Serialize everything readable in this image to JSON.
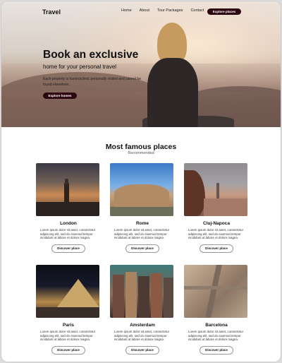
{
  "nav": {
    "brand": "Travel",
    "links": [
      "Home",
      "About",
      "Tour Packages",
      "Contact"
    ],
    "cta": "Explore places"
  },
  "hero": {
    "title": "Book an exclusive",
    "subtitle": "home for your personal travel",
    "description": "Each property is hand-picked, personally visited and cannot be found elsewhere.",
    "cta": "Explore homes"
  },
  "places_section": {
    "title": "Most famous places",
    "subtitle": "Recommended"
  },
  "places": [
    {
      "name": "London",
      "desc": "Lorem ipsum dolor sit amet, consectetur adipiscing elit, sed do eiusmod tempor incididunt ut labore et dolore magna.",
      "button": "Discover place"
    },
    {
      "name": "Rome",
      "desc": "Lorem ipsum dolor sit amet, consectetur adipiscing elit, sed do eiusmod tempor incididunt ut labore et dolore magna.",
      "button": "Discover place"
    },
    {
      "name": "Cluj-Napoca",
      "desc": "Lorem ipsum dolor sit amet, consectetur adipiscing elit, sed do eiusmod tempor incididunt ut labore et dolore magna.",
      "button": "Discover place"
    },
    {
      "name": "Paris",
      "desc": "Lorem ipsum dolor sit amet, consectetur adipiscing elit, sed do eiusmod tempor incididunt ut labore et dolore magna.",
      "button": "Discover place"
    },
    {
      "name": "Amsterdam",
      "desc": "Lorem ipsum dolor sit amet, consectetur adipiscing elit, sed do eiusmod tempor incididunt ut labore et dolore magna.",
      "button": "Discover place"
    },
    {
      "name": "Barcelona",
      "desc": "Lorem ipsum dolor sit amet, consectetur adipiscing elit, sed do eiusmod tempor incididunt ut labore et dolore magna.",
      "button": "Discover place"
    }
  ],
  "colors": {
    "accent": "#2e0611",
    "text": "#111111"
  }
}
